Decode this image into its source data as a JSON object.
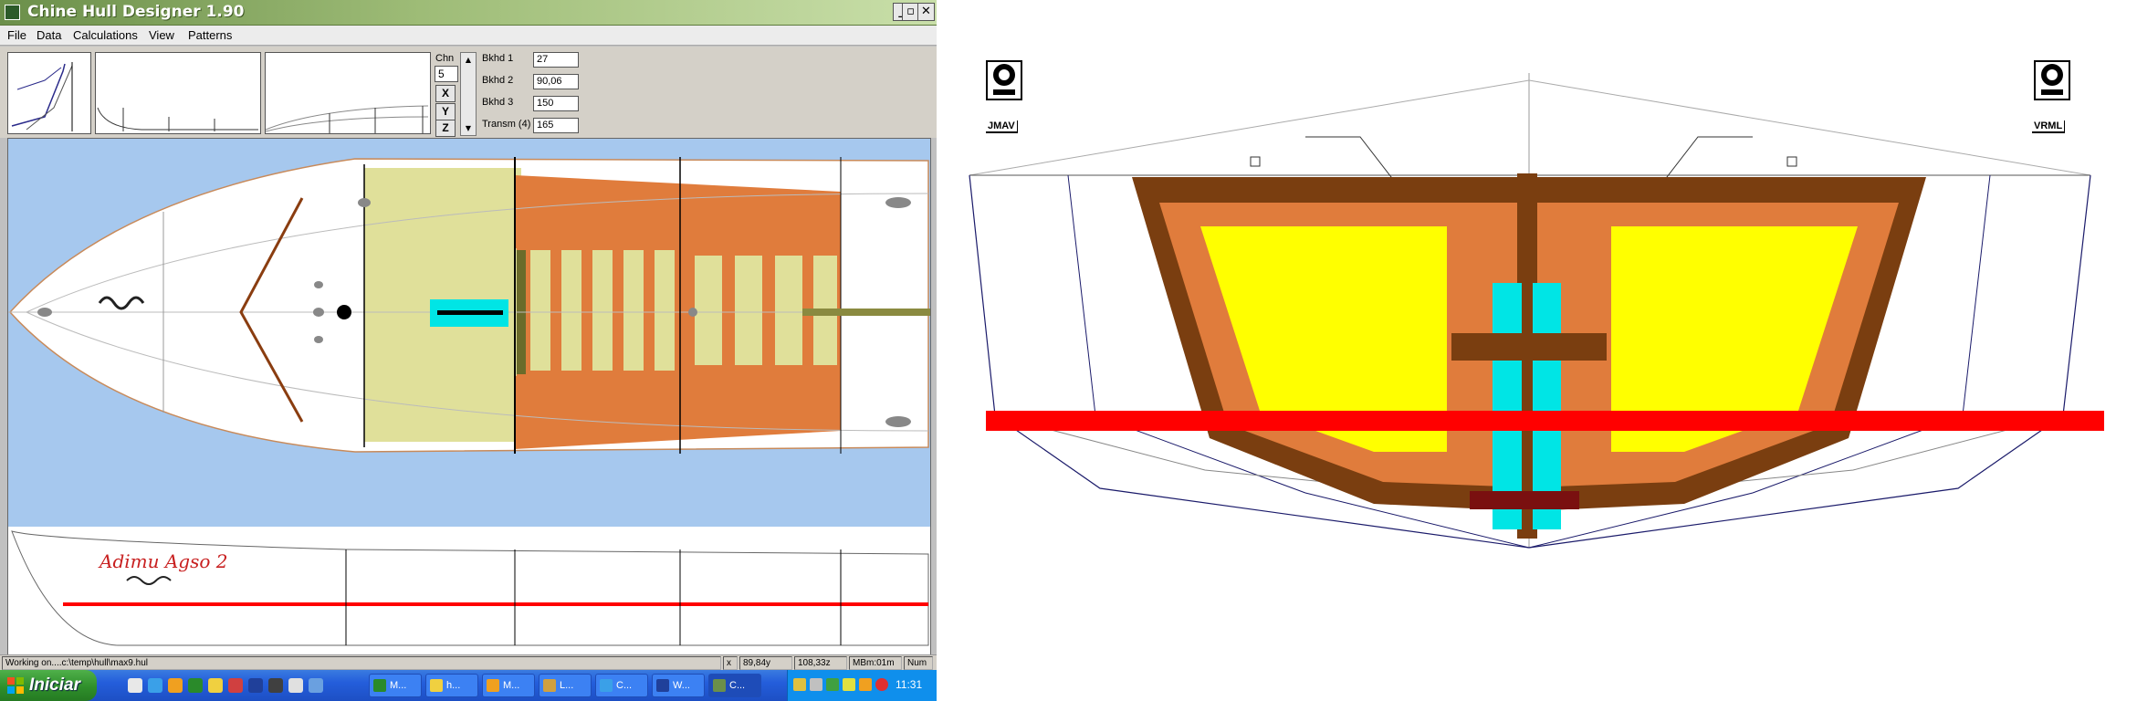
{
  "window": {
    "title": "Chine Hull Designer 1.90",
    "min_glyph": "_",
    "max_glyph": "▫",
    "close_glyph": "✕"
  },
  "menu": [
    "File",
    "Data",
    "Calculations",
    "View",
    "Patterns"
  ],
  "toolbar": {
    "chn_label": "Chn",
    "chn_value": "5",
    "axis_buttons": [
      "X",
      "Y",
      "Z"
    ],
    "bulkheads": [
      {
        "label": "Bkhd 1",
        "value": "27"
      },
      {
        "label": "Bkhd 2",
        "value": "90,06"
      },
      {
        "label": "Bkhd 3",
        "value": "150"
      },
      {
        "label": "Transm (4)",
        "value": "165"
      }
    ]
  },
  "canvas": {
    "hull_name": "Adimu Agso 2"
  },
  "statusbar": {
    "path": "Working on....c:\\temp\\hull\\max9.hul",
    "x_label": "x",
    "coord1": "89,84y",
    "coord2": "108,33z",
    "mode": "MBm:01m",
    "num": "Num"
  },
  "taskbar": {
    "start_label": "Iniciar",
    "tasks": [
      "M...",
      "h...",
      "M...",
      "L...",
      "C...",
      "W...",
      "C..."
    ],
    "clock": "11:31"
  },
  "colors": {
    "water": "#a6c8ee",
    "deck_light": "#e0e09a",
    "deck_orange": "#e07c3c",
    "waterline": "#ff0000",
    "frame_brown": "#7a3e10",
    "panel_yellow": "#ffff00",
    "keel_cyan": "#00e5e5"
  },
  "right_drawing": {
    "logo_left_label": "JMAV",
    "logo_right_label": "VRML"
  }
}
